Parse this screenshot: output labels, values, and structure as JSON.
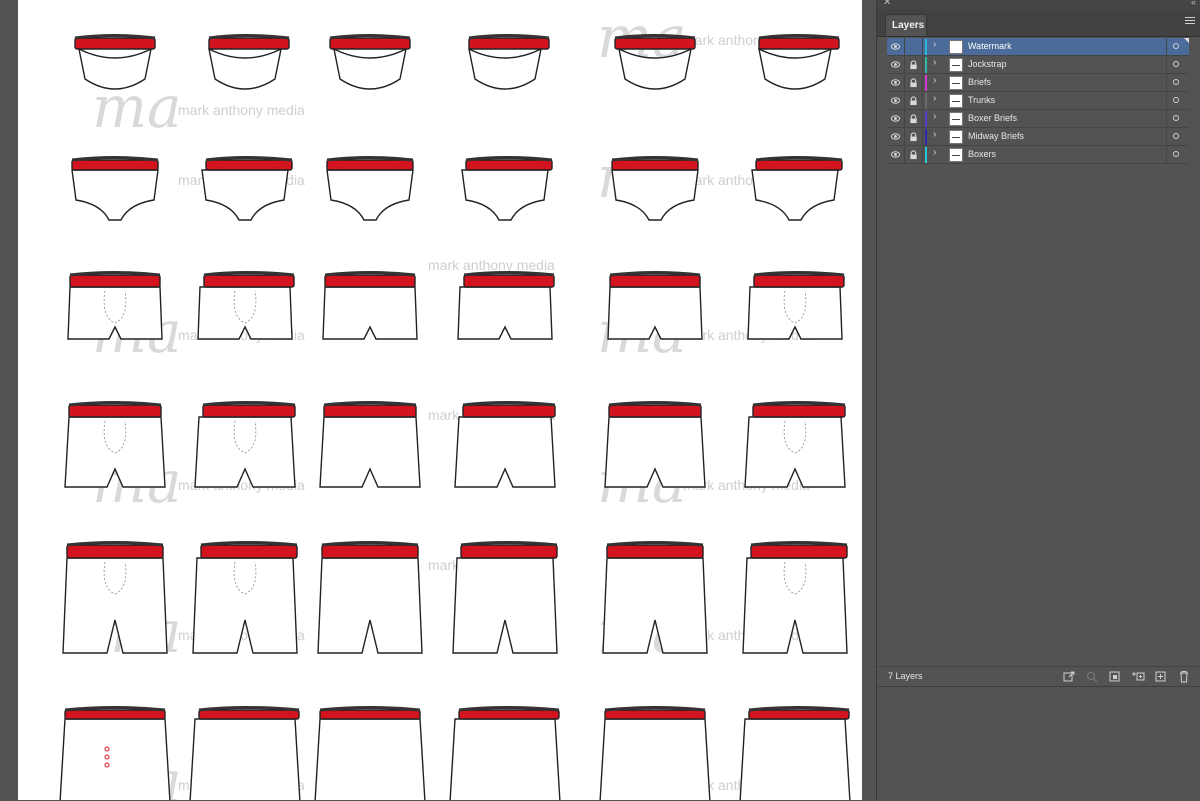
{
  "panel": {
    "close_glyph": "✕",
    "collapse_glyph": "«",
    "tab_label": "Layers",
    "layer_count": "7 Layers",
    "menu_icon": "hamburger-icon"
  },
  "layers": [
    {
      "name": "Watermark",
      "color": "#27b5d8",
      "locked": false,
      "selected": true
    },
    {
      "name": "Jockstrap",
      "color": "#2fb8a8",
      "locked": true,
      "selected": false
    },
    {
      "name": "Briefs",
      "color": "#d33ad1",
      "locked": true,
      "selected": false
    },
    {
      "name": "Trunks",
      "color": "#6a6a6a",
      "locked": true,
      "selected": false
    },
    {
      "name": "Boxer Briefs",
      "color": "#5a3ad1",
      "locked": true,
      "selected": false
    },
    {
      "name": "Midway Briefs",
      "color": "#2a2ab8",
      "locked": true,
      "selected": false
    },
    {
      "name": "Boxers",
      "color": "#27c7d8",
      "locked": true,
      "selected": false
    }
  ],
  "footer_icons": [
    "export-icon",
    "locate-icon",
    "clipping-mask-icon",
    "sublayer-icon",
    "new-layer-icon",
    "trash-icon"
  ],
  "watermark": {
    "text": "mark anthony media",
    "logo_glyph": "ma"
  },
  "artboard": {
    "waistband_color": "#d3141f",
    "rows": [
      "jockstrap",
      "briefs",
      "trunks",
      "boxer-briefs",
      "midway-briefs",
      "boxers"
    ]
  }
}
